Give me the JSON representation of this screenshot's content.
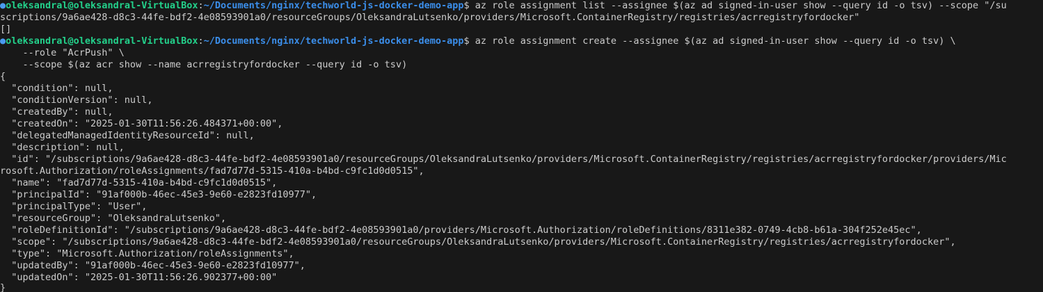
{
  "terminal": {
    "prompt": {
      "bullet": "●",
      "user_host": "oleksandral@oleksandral-VirtualBox",
      "separator": ":",
      "cwd": "~/Documents/nginx/techworld-js-docker-demo-app",
      "symbol": "$ "
    },
    "commands": {
      "first": "az role assignment list --assignee $(az ad signed-in-user show --query id -o tsv) --scope \"/su",
      "first_wrap": "scriptions/9a6ae428-d8c3-44fe-bdf2-4e08593901a0/resourceGroups/OleksandraLutsenko/providers/Microsoft.ContainerRegistry/registries/acrregistryfordocker\"",
      "first_output": "[]",
      "second": "az role assignment create --assignee $(az ad signed-in-user show --query id -o tsv) \\",
      "second_cont1": "    --role \"AcrPush\" \\",
      "second_cont2": "    --scope $(az acr show --name acrregistryfordocker --query id -o tsv)"
    },
    "output": [
      "{",
      "  \"condition\": null,",
      "  \"conditionVersion\": null,",
      "  \"createdBy\": null,",
      "  \"createdOn\": \"2025-01-30T11:56:26.484371+00:00\",",
      "  \"delegatedManagedIdentityResourceId\": null,",
      "  \"description\": null,",
      "  \"id\": \"/subscriptions/9a6ae428-d8c3-44fe-bdf2-4e08593901a0/resourceGroups/OleksandraLutsenko/providers/Microsoft.ContainerRegistry/registries/acrregistryfordocker/providers/Mic",
      "rosoft.Authorization/roleAssignments/fad7d77d-5315-410a-b4bd-c9fc1d0d0515\",",
      "  \"name\": \"fad7d77d-5315-410a-b4bd-c9fc1d0d0515\",",
      "  \"principalId\": \"91af000b-46ec-45e3-9e60-e2823fd10977\",",
      "  \"principalType\": \"User\",",
      "  \"resourceGroup\": \"OleksandraLutsenko\",",
      "  \"roleDefinitionId\": \"/subscriptions/9a6ae428-d8c3-44fe-bdf2-4e08593901a0/providers/Microsoft.Authorization/roleDefinitions/8311e382-0749-4cb8-b61a-304f252e45ec\",",
      "  \"scope\": \"/subscriptions/9a6ae428-d8c3-44fe-bdf2-4e08593901a0/resourceGroups/OleksandraLutsenko/providers/Microsoft.ContainerRegistry/registries/acrregistryfordocker\",",
      "  \"type\": \"Microsoft.Authorization/roleAssignments\",",
      "  \"updatedBy\": \"91af000b-46ec-45e3-9e60-e2823fd10977\",",
      "  \"updatedOn\": \"2025-01-30T11:56:26.902377+00:00\"",
      "}"
    ]
  },
  "colors": {
    "background": "#181818",
    "foreground": "#cccccc",
    "user_host": "#23d18b",
    "path": "#3b8eea",
    "bullet": "#4a9af0"
  }
}
